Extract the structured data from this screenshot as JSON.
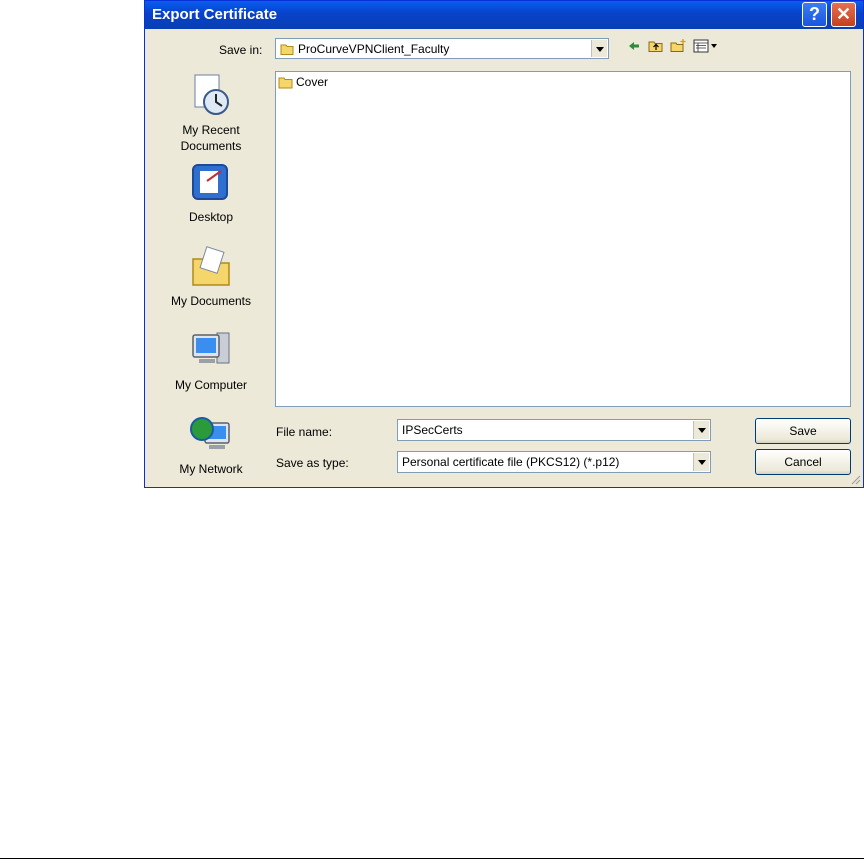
{
  "window": {
    "title": "Export Certificate",
    "help_glyph": "?",
    "close_glyph": "✕"
  },
  "save_in": {
    "label": "Save in:",
    "value": "ProCurveVPNClient_Faculty"
  },
  "toolbar": {
    "icons": [
      "back-arrow-icon",
      "up-folder-icon",
      "new-folder-icon",
      "view-menu-icon"
    ]
  },
  "files": [
    {
      "name": "Cover",
      "icon": "folder-icon"
    }
  ],
  "places": [
    {
      "label": "My Recent\nDocuments",
      "icon": "recent-documents-icon"
    },
    {
      "label": "Desktop",
      "icon": "desktop-icon"
    },
    {
      "label": "My Documents",
      "icon": "my-documents-icon"
    },
    {
      "label": "My Computer",
      "icon": "my-computer-icon"
    },
    {
      "label": "My Network",
      "icon": "my-network-icon"
    }
  ],
  "file_name": {
    "label": "File name:",
    "value": "IPSecCerts"
  },
  "save_as_type": {
    "label": "Save as type:",
    "value": "Personal certificate file (PKCS12) (*.p12)"
  },
  "buttons": {
    "save": "Save",
    "cancel": "Cancel"
  }
}
